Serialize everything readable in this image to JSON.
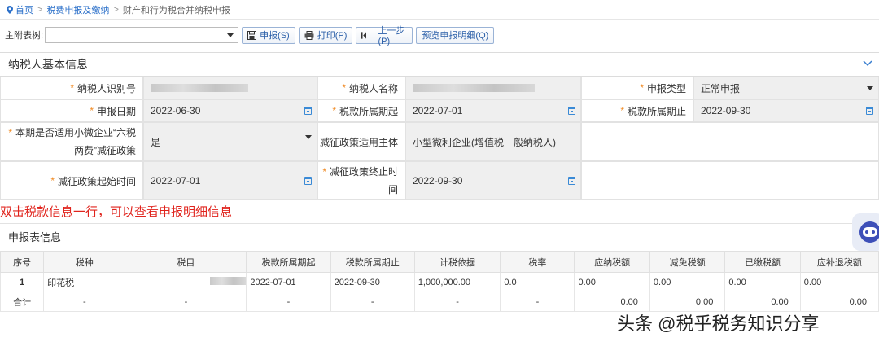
{
  "breadcrumb": {
    "home": "首页",
    "level2": "税费申报及缴纳",
    "current": "财产和行为税合并纳税申报",
    "sep": ">"
  },
  "toolbar": {
    "table_label": "主附表树:",
    "select_value": "",
    "buttons": [
      {
        "label": "申报(S)",
        "icon": "save-icon"
      },
      {
        "label": "打印(P)",
        "icon": "print-icon"
      },
      {
        "label": "上一步(P)",
        "icon": "prev-icon"
      },
      {
        "label": "预览申报明细(Q)",
        "icon": ""
      }
    ]
  },
  "taxpayer_section": {
    "title": "纳税人基本信息",
    "fields": {
      "taxpayer_id_label": "纳税人识别号",
      "taxpayer_name_label": "纳税人名称",
      "decl_type_label": "申报类型",
      "decl_type_value": "正常申报",
      "decl_date_label": "申报日期",
      "decl_date_value": "2022-06-30",
      "period_start_label": "税款所属期起",
      "period_start_value": "2022-07-01",
      "period_end_label": "税款所属期止",
      "period_end_value": "2022-09-30",
      "small_micro_label_1": "本期是否适用小微企业“六税",
      "small_micro_label_2": "两费”减征政策",
      "small_micro_value": "是",
      "reduce_subject_label": "减征政策适用主体",
      "reduce_subject_value": "小型微利企业(增值税一般纳税人)",
      "reduce_start_label": "减征政策起始时间",
      "reduce_start_value": "2022-07-01",
      "reduce_end_label_1": "减征政策终止时",
      "reduce_end_label_2": "间",
      "reduce_end_value": "2022-09-30",
      "required_mark": "*"
    }
  },
  "note": "双击税款信息一行，可以查看申报明细信息",
  "declaration_section": {
    "title": "申报表信息",
    "columns": [
      "序号",
      "税种",
      "税目",
      "税款所属期起",
      "税款所属期止",
      "计税依据",
      "税率",
      "应纳税额",
      "减免税额",
      "已缴税额",
      "应补退税额"
    ],
    "row": {
      "no": "1",
      "tax_type": "印花税",
      "period_start": "2022-07-01",
      "period_end": "2022-09-30",
      "basis": "1,000,000.00",
      "rate": "0.0",
      "payable": "0.00",
      "relief": "0.00",
      "paid": "0.00",
      "refund": "0.00"
    },
    "total": {
      "label": "合计",
      "dash": "-",
      "payable": "0.00",
      "relief": "0.00",
      "paid": "0.00",
      "refund": "0.00"
    }
  },
  "watermark": "头条 @税乎税务知识分享",
  "colors": {
    "link": "#2a6fc9",
    "required": "#f08a24",
    "note": "#e0231c",
    "readonly_bg": "#efefef"
  }
}
